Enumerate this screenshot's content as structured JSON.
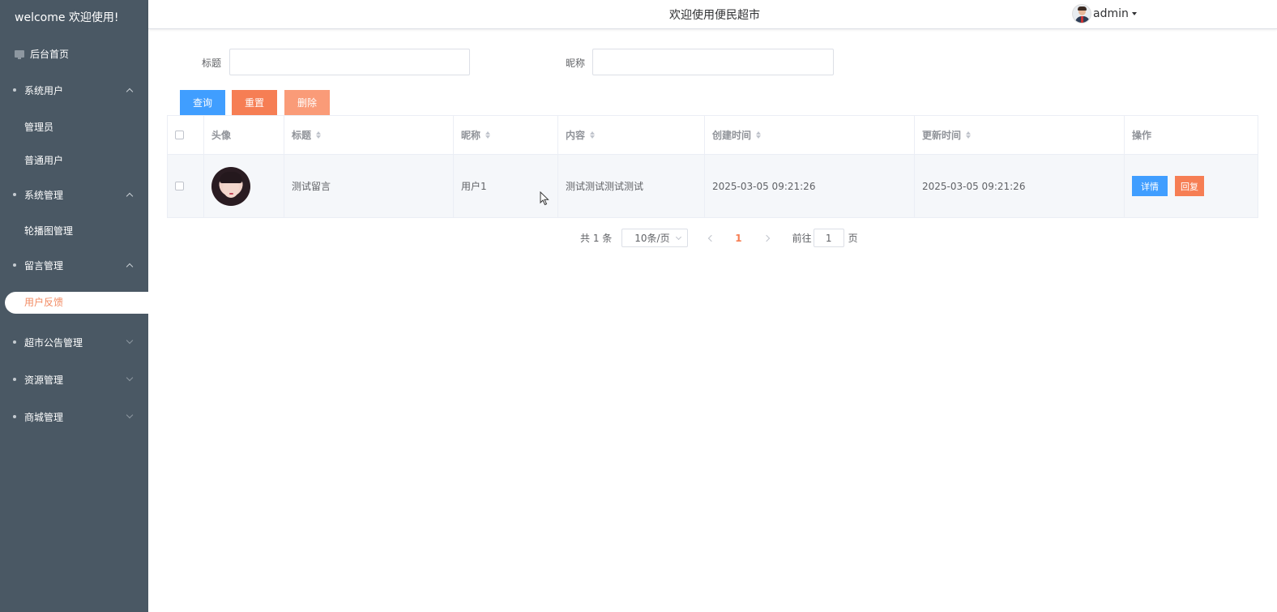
{
  "sidebar": {
    "brand": "welcome 欢迎使用!",
    "home": "后台首页",
    "groups": [
      {
        "label": "系统用户",
        "expanded": true,
        "items": [
          "管理员",
          "普通用户"
        ]
      },
      {
        "label": "系统管理",
        "expanded": true,
        "items": [
          "轮播图管理"
        ]
      },
      {
        "label": "留言管理",
        "expanded": true,
        "items": [
          "用户反馈"
        ]
      },
      {
        "label": "超市公告管理",
        "expanded": false,
        "items": []
      },
      {
        "label": "资源管理",
        "expanded": false,
        "items": []
      },
      {
        "label": "商城管理",
        "expanded": false,
        "items": []
      }
    ],
    "active_item": "用户反馈"
  },
  "header": {
    "title": "欢迎使用便民超市",
    "user": "admin"
  },
  "search": {
    "title_label": "标题",
    "title_value": "",
    "nickname_label": "昵称",
    "nickname_value": ""
  },
  "toolbar": {
    "query": "查询",
    "reset": "重置",
    "delete": "删除"
  },
  "table": {
    "columns": [
      "头像",
      "标题",
      "昵称",
      "内容",
      "创建时间",
      "更新时间",
      "操作"
    ],
    "rows": [
      {
        "title": "测试留言",
        "nickname": "用户1",
        "content": "测试测试测试测试",
        "created": "2025-03-05 09:21:26",
        "updated": "2025-03-05 09:21:26",
        "actions": [
          "详情",
          "回复"
        ]
      }
    ]
  },
  "pagination": {
    "total_text": "共 1 条",
    "page_size": "10条/页",
    "current_page": "1",
    "goto_label": "前往",
    "goto_value": "1",
    "page_suffix": "页"
  },
  "colors": {
    "sidebar_bg": "#4a5864",
    "primary": "#409eff",
    "warning": "#f67e54",
    "danger_light": "#fa9b78",
    "active_text": "#f28b63"
  }
}
